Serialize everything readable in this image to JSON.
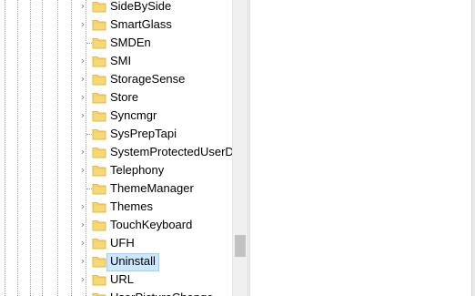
{
  "tree": {
    "items": [
      {
        "label": "SideBySide",
        "expandable": true,
        "selected": false
      },
      {
        "label": "SmartGlass",
        "expandable": true,
        "selected": false
      },
      {
        "label": "SMDEn",
        "expandable": false,
        "selected": false
      },
      {
        "label": "SMI",
        "expandable": true,
        "selected": false
      },
      {
        "label": "StorageSense",
        "expandable": true,
        "selected": false
      },
      {
        "label": "Store",
        "expandable": true,
        "selected": false
      },
      {
        "label": "Syncmgr",
        "expandable": true,
        "selected": false
      },
      {
        "label": "SysPrepTapi",
        "expandable": false,
        "selected": false
      },
      {
        "label": "SystemProtectedUserD",
        "expandable": true,
        "selected": false
      },
      {
        "label": "Telephony",
        "expandable": true,
        "selected": false
      },
      {
        "label": "ThemeManager",
        "expandable": false,
        "selected": false
      },
      {
        "label": "Themes",
        "expandable": true,
        "selected": false
      },
      {
        "label": "TouchKeyboard",
        "expandable": true,
        "selected": false
      },
      {
        "label": "UFH",
        "expandable": true,
        "selected": false
      },
      {
        "label": "Uninstall",
        "expandable": true,
        "selected": true
      },
      {
        "label": "URL",
        "expandable": true,
        "selected": false
      },
      {
        "label": "UserPictureChange",
        "expandable": true,
        "selected": false
      }
    ]
  },
  "icons": {
    "expand": "chevron-right-icon",
    "folder": "folder-icon"
  },
  "colors": {
    "folder_fill": "#f8d775",
    "folder_edge": "#e0b84a",
    "selection_bg": "#cce8ff",
    "selection_border": "#99d1ff",
    "tree_line": "#a0a0a0",
    "scrollbar_track": "#f0f0f0",
    "scrollbar_thumb": "#c2c2c2"
  }
}
